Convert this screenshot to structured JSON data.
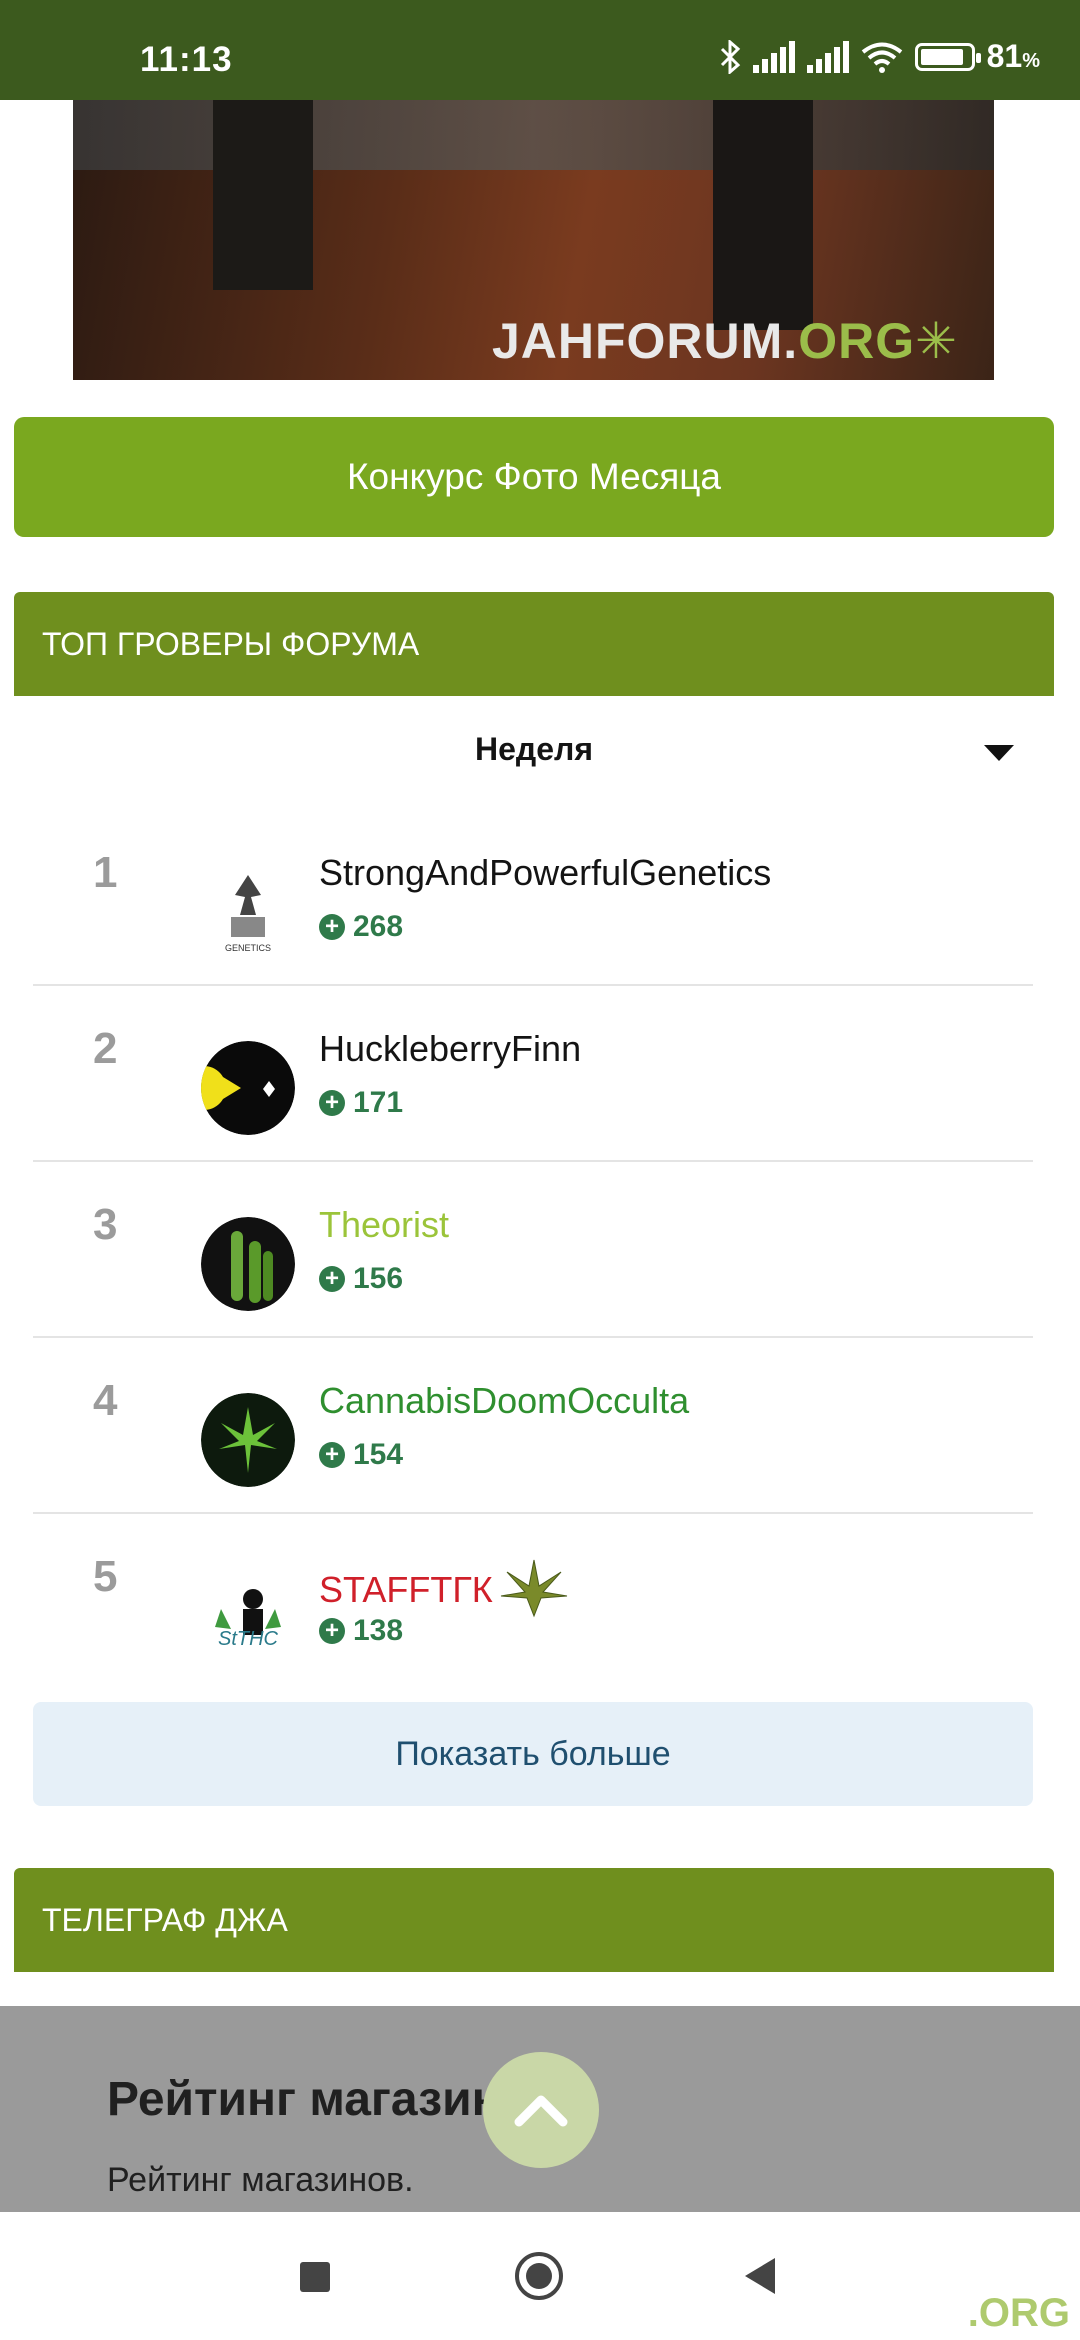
{
  "status_bar": {
    "time": "11:13",
    "battery_value": "81",
    "battery_unit": "%"
  },
  "banner": {
    "watermark_main": "JAHFORUM.",
    "watermark_org": "ORG"
  },
  "contest_button": "Конкурс Фото Месяца",
  "top_growers": {
    "header": "ТОП ГРОВЕРЫ ФОРУМА",
    "period": "Неделя",
    "items": [
      {
        "rank": "1",
        "name": "StrongAndPowerfulGenetics",
        "score": "268",
        "color": "#141414"
      },
      {
        "rank": "2",
        "name": "HuckleberryFinn",
        "score": "171",
        "color": "#141414"
      },
      {
        "rank": "3",
        "name": "Theorist",
        "score": "156",
        "color": "#9bc43a"
      },
      {
        "rank": "4",
        "name": "CannabisDoomOcculta",
        "score": "154",
        "color": "#2f8f2f"
      },
      {
        "rank": "5",
        "name": "STAFFTГК",
        "score": "138",
        "color": "#d0202a"
      }
    ],
    "show_more": "Показать больше"
  },
  "telegraph": {
    "header": "ТЕЛЕГРАФ ДЖА"
  },
  "card": {
    "title": "Рейтинг магазинов.",
    "subtitle": "Рейтинг магазинов."
  },
  "corner_watermark": ".ORG",
  "colors": {
    "status_bar": "#3c5a1e",
    "accent_green": "#7aa81f",
    "header_green": "#6f8f1e",
    "score_green": "#2f7a4a"
  }
}
